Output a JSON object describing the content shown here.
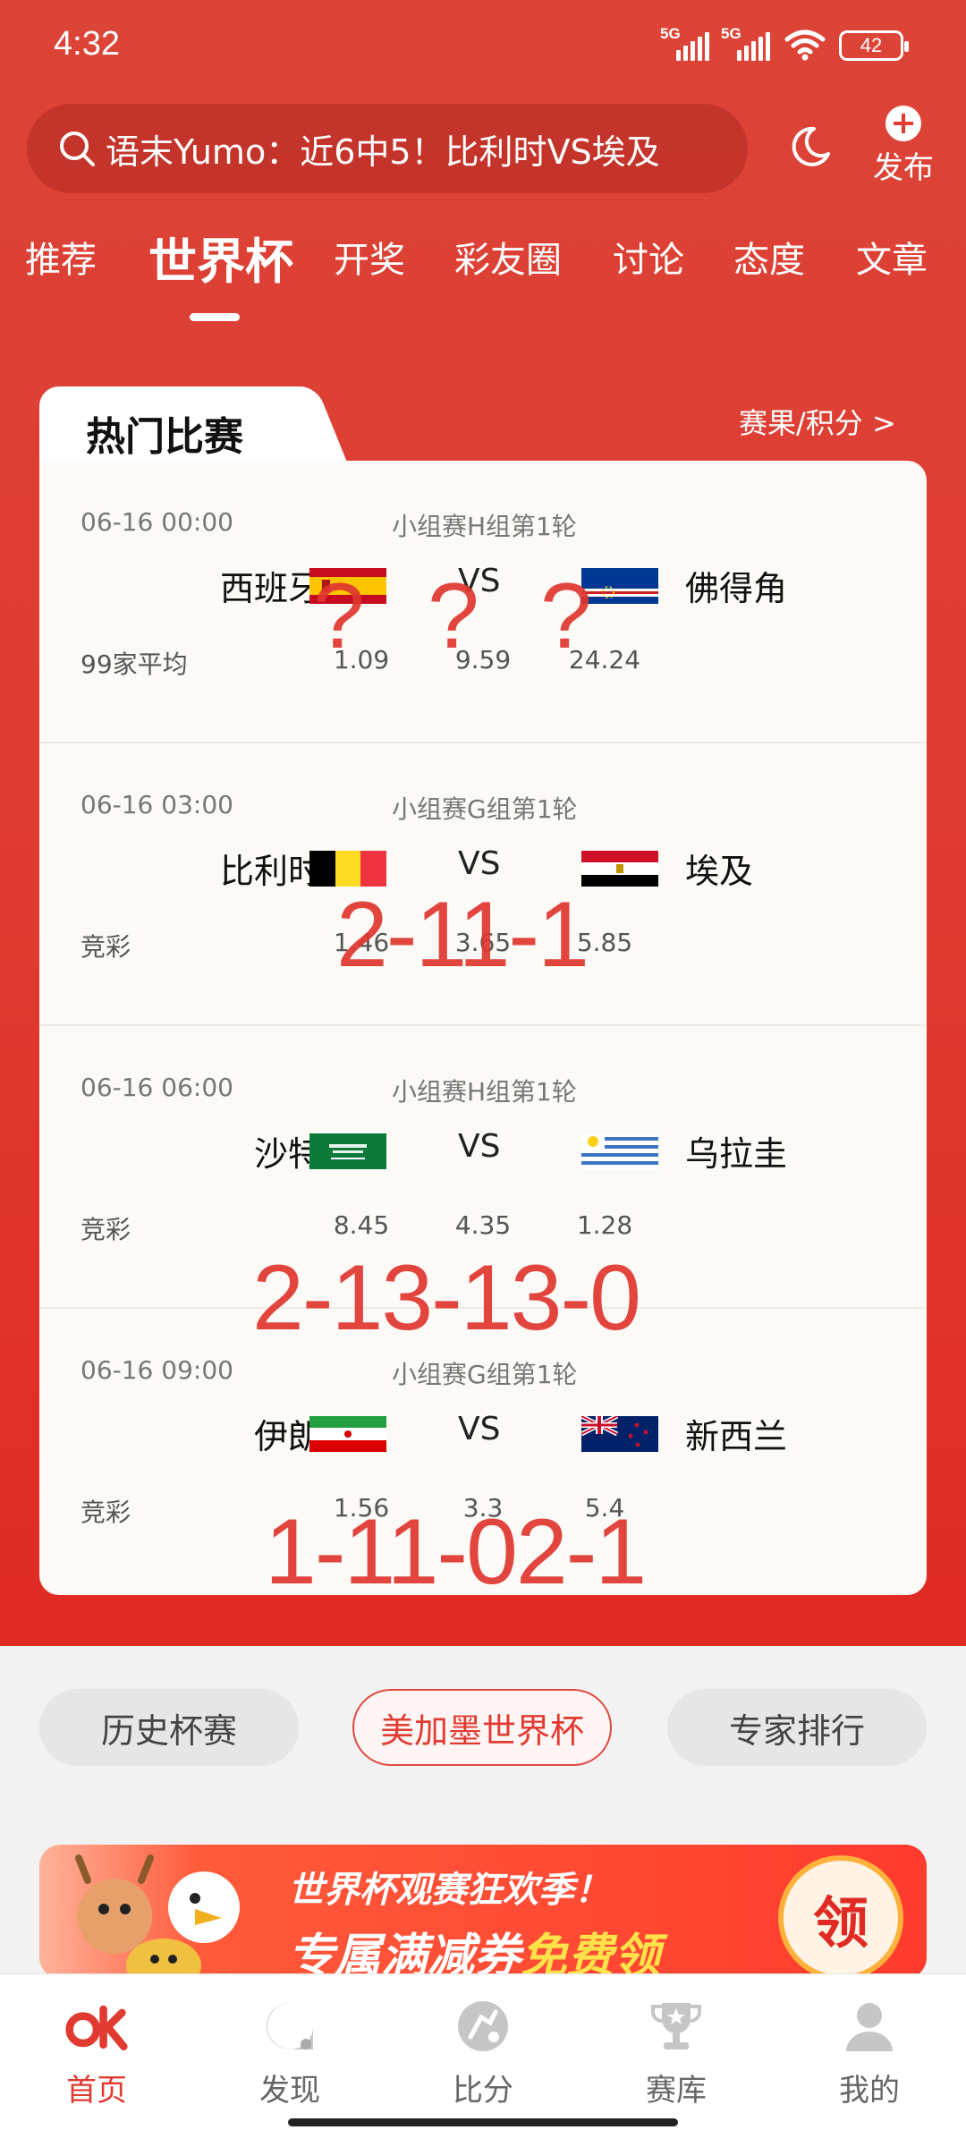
{
  "status_bar": {
    "time": "4:32",
    "signal1": "5G",
    "signal2": "5G",
    "battery": "42"
  },
  "search": {
    "text": "语末Yumo：近6中5！比利时VS埃及"
  },
  "header": {
    "publish_label": "发布"
  },
  "tabs": [
    {
      "label": "推荐"
    },
    {
      "label": "世界杯",
      "active": true
    },
    {
      "label": "开奖"
    },
    {
      "label": "彩友圈"
    },
    {
      "label": "讨论"
    },
    {
      "label": "态度"
    },
    {
      "label": "文章"
    }
  ],
  "hot": {
    "title": "热门比赛",
    "link": "赛果/积分 >"
  },
  "matches": [
    {
      "datetime": "06-16 00:00",
      "stage": "小组赛H组第1轮",
      "home": "西班牙",
      "away": "佛得角",
      "vs": "VS",
      "source": "99家平均",
      "odds": [
        "1.09",
        "9.59",
        "24.24"
      ],
      "home_flag": "spain",
      "away_flag": "cape-verde"
    },
    {
      "datetime": "06-16 03:00",
      "stage": "小组赛G组第1轮",
      "home": "比利时",
      "away": "埃及",
      "vs": "VS",
      "source": "竞彩",
      "odds": [
        "1.46",
        "3.65",
        "5.85"
      ],
      "home_flag": "belgium",
      "away_flag": "egypt"
    },
    {
      "datetime": "06-16 06:00",
      "stage": "小组赛H组第1轮",
      "home": "沙特",
      "away": "乌拉圭",
      "vs": "VS",
      "source": "竞彩",
      "odds": [
        "8.45",
        "4.35",
        "1.28"
      ],
      "home_flag": "saudi-arabia",
      "away_flag": "uruguay"
    },
    {
      "datetime": "06-16 09:00",
      "stage": "小组赛G组第1轮",
      "home": "伊朗",
      "away": "新西兰",
      "vs": "VS",
      "source": "竞彩",
      "odds": [
        "1.56",
        "3.3",
        "5.4"
      ],
      "home_flag": "iran",
      "away_flag": "new-zealand"
    }
  ],
  "overlays": {
    "q1": "?",
    "q2": "?",
    "q3": "?",
    "m2": "2-11-1",
    "m3": "2-13-13-0",
    "m4": "1-11-02-1"
  },
  "chips": [
    {
      "label": "历史杯赛"
    },
    {
      "label": "美加墨世界杯",
      "selected": true
    },
    {
      "label": "专家排行"
    }
  ],
  "banner": {
    "line1": "世界杯观赛狂欢季！",
    "line2_pre": "专属满减券",
    "line2_hl": "免费领",
    "badge": "领"
  },
  "bottom_nav": [
    {
      "label": "首页",
      "icon": "ok-logo-icon",
      "active": true
    },
    {
      "label": "发现",
      "icon": "discover-icon"
    },
    {
      "label": "比分",
      "icon": "soccer-ball-icon"
    },
    {
      "label": "赛库",
      "icon": "trophy-icon"
    },
    {
      "label": "我的",
      "icon": "profile-icon"
    }
  ],
  "colors": {
    "brand": "#e03a31",
    "hero_bg": "#dc4437",
    "card_bg": "#fbfaf7",
    "overlay": "#e0362f"
  }
}
